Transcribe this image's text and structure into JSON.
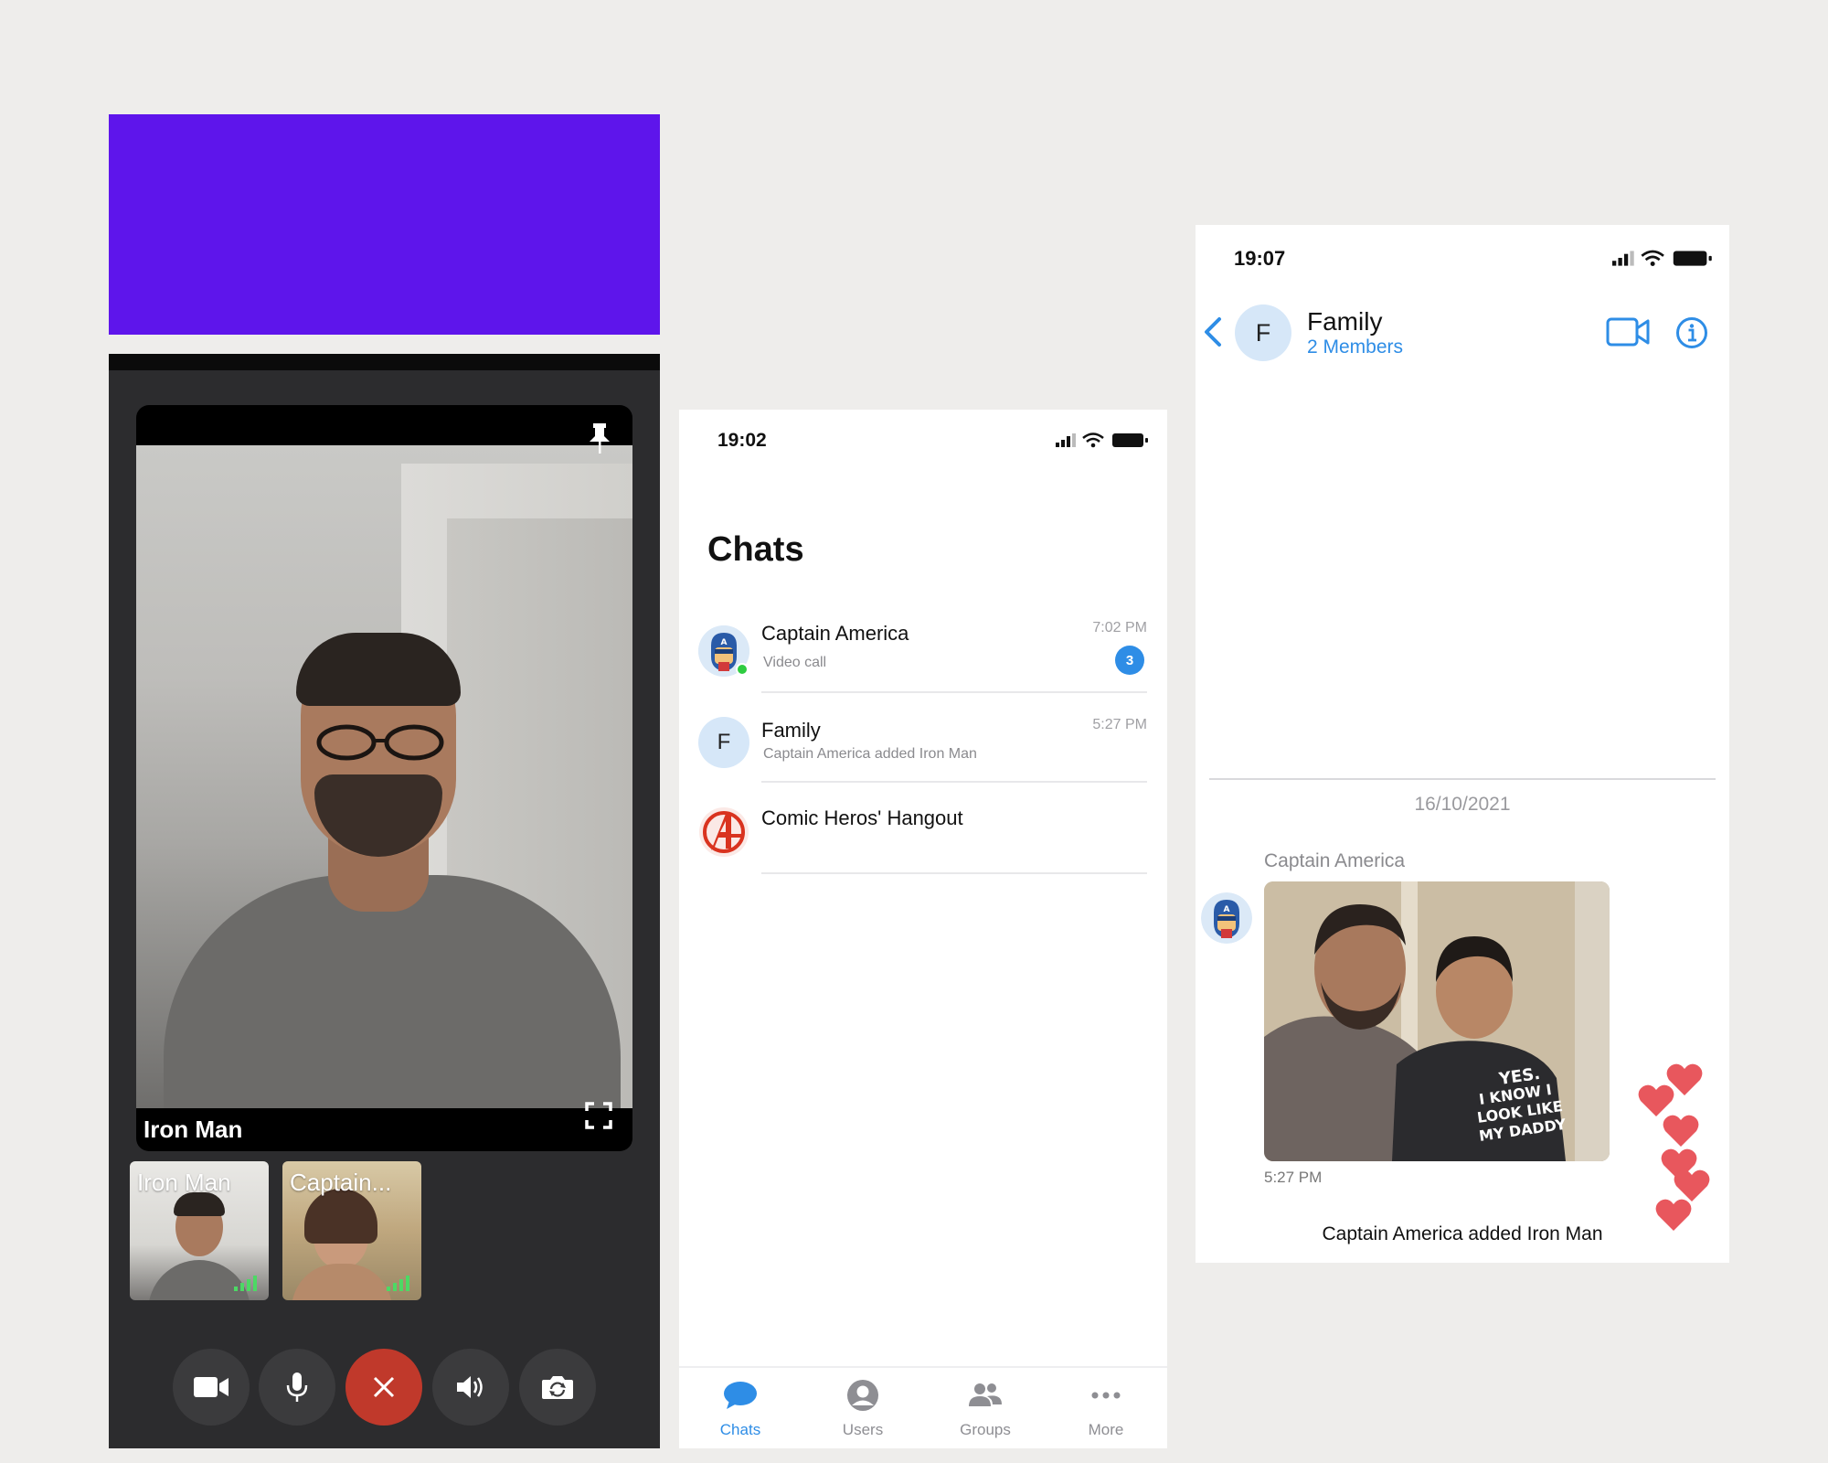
{
  "colors": {
    "purple": "#5e15eb",
    "accent_blue": "#2e8de6",
    "end_call_red": "#c0392b",
    "online_green": "#2ecc40",
    "heart_red": "#e8575d"
  },
  "call": {
    "main_participant": "Iron Man",
    "thumbnails": [
      {
        "name": "Iron Man"
      },
      {
        "name": "Captain..."
      }
    ],
    "controls": [
      "video-camera-icon",
      "microphone-icon",
      "end-call-icon",
      "speaker-icon",
      "switch-camera-icon"
    ]
  },
  "chats": {
    "status_time": "19:02",
    "title": "Chats",
    "items": [
      {
        "name": "Captain America",
        "subtitle": "Video call",
        "time": "7:02 PM",
        "unread": "3",
        "avatar": "captain-america-avatar",
        "online": true
      },
      {
        "name": "Family",
        "subtitle": "Captain America added Iron Man",
        "time": "5:27 PM",
        "avatar_letter": "F"
      },
      {
        "name": "Comic Heros' Hangout",
        "subtitle": "",
        "time": "",
        "avatar": "avengers-logo-avatar"
      }
    ],
    "tabs": [
      {
        "label": "Chats",
        "icon": "chat-bubble-icon",
        "active": true
      },
      {
        "label": "Users",
        "icon": "user-icon"
      },
      {
        "label": "Groups",
        "icon": "groups-icon"
      },
      {
        "label": "More",
        "icon": "more-dots-icon"
      }
    ]
  },
  "family": {
    "status_time": "19:07",
    "avatar_letter": "F",
    "title": "Family",
    "members": "2 Members",
    "date": "16/10/2021",
    "sender": "Captain America",
    "message_time": "5:27 PM",
    "action_message": "Captain America added Iron Man",
    "shirt_text": "YES. I KNOW I LOOK LIKE MY DADDY"
  }
}
